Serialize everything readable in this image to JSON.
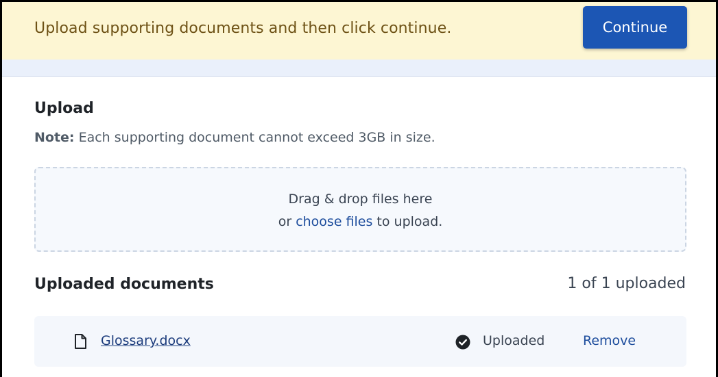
{
  "banner": {
    "message": "Upload supporting documents and then click continue.",
    "continue_label": "Continue"
  },
  "upload": {
    "title": "Upload",
    "note_label": "Note:",
    "note_text": " Each supporting document cannot exceed 3GB in size.",
    "drop_line1": "Drag & drop files here",
    "drop_prefix": "or ",
    "choose_link": "choose files",
    "drop_suffix": " to upload."
  },
  "uploaded": {
    "title": "Uploaded documents",
    "count": "1 of 1 uploaded",
    "files": [
      {
        "name": "Glossary.docx",
        "status": "Uploaded",
        "remove_label": "Remove"
      }
    ]
  },
  "icons": {
    "file": "file-icon",
    "status": "check-circle-icon"
  },
  "colors": {
    "banner_bg": "#fdf6d3",
    "banner_text": "#6e5216",
    "primary": "#1c56b4",
    "link": "#1c4c9c"
  }
}
